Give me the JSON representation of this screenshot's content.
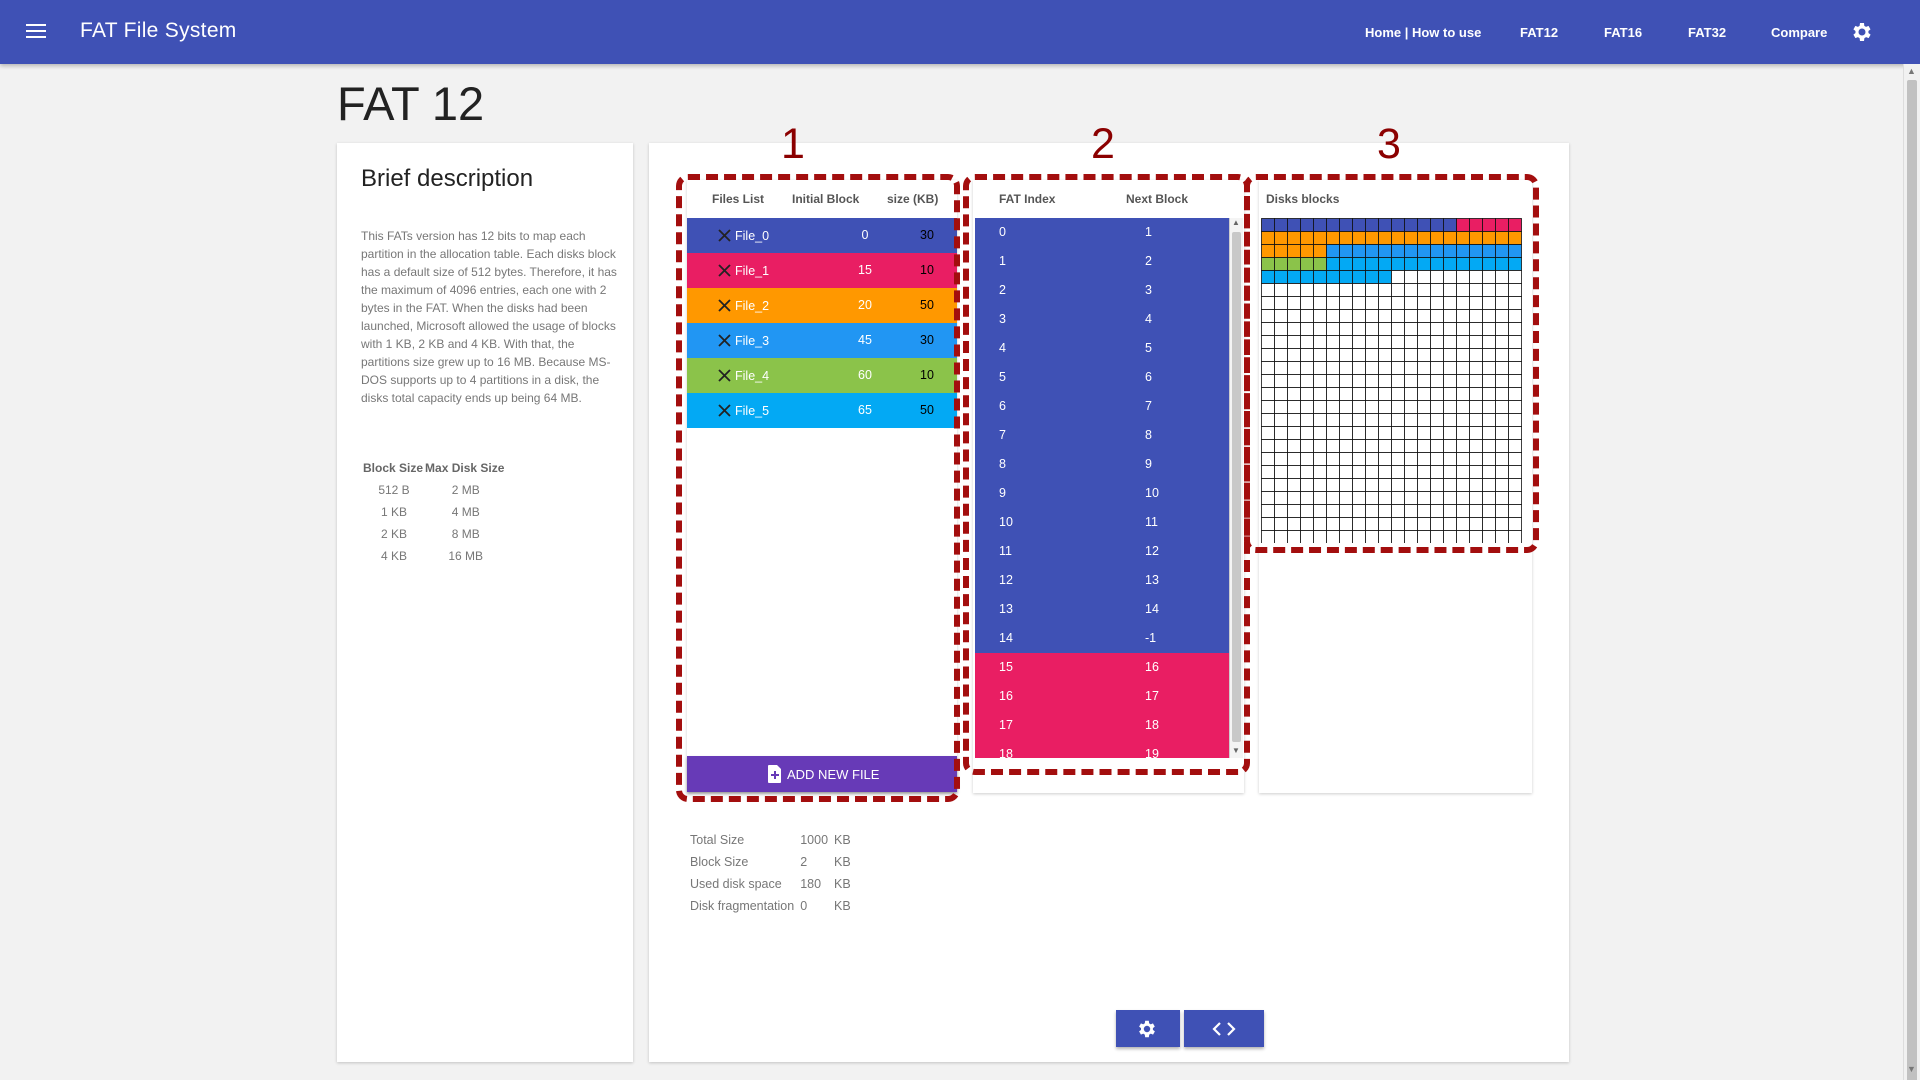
{
  "appbar": {
    "title": "FAT File System",
    "nav": [
      {
        "label": "Home | How to use"
      },
      {
        "label": "FAT12"
      },
      {
        "label": "FAT16"
      },
      {
        "label": "FAT32"
      },
      {
        "label": "Compare"
      }
    ]
  },
  "page_title": "FAT 12",
  "description": {
    "heading": "Brief description",
    "text": "This FATs version has 12 bits to map each partition in the allocation table. Each disks block has a default size of 512 bytes. Therefore, it has the maximum of 4096 entries, each one with 2 bytes in the FAT. When the disks had been launched, Microsoft allowed the usage of blocks with 1 KB, 2 KB and 4 KB. With that, the partitions size grew up to 16 MB. Because MS-DOS supports up to 4 partitions in a disk, the disks total capacity ends up being 64 MB.",
    "table_headers": [
      "Block Size",
      "Max Disk Size"
    ],
    "table_rows": [
      [
        "512 B",
        "2 MB"
      ],
      [
        "1 KB",
        "4 MB"
      ],
      [
        "2 KB",
        "8 MB"
      ],
      [
        "4 KB",
        "16 MB"
      ]
    ]
  },
  "annotations": [
    "1",
    "2",
    "3"
  ],
  "files_panel": {
    "headers": [
      "Files List",
      "Initial Block",
      "size (KB)"
    ],
    "files": [
      {
        "name": "File_0",
        "initial_block": "0",
        "size": "30",
        "color": "#3f51b5"
      },
      {
        "name": "File_1",
        "initial_block": "15",
        "size": "10",
        "color": "#e91e63"
      },
      {
        "name": "File_2",
        "initial_block": "20",
        "size": "50",
        "color": "#ff9800"
      },
      {
        "name": "File_3",
        "initial_block": "45",
        "size": "30",
        "color": "#2196f3"
      },
      {
        "name": "File_4",
        "initial_block": "60",
        "size": "10",
        "color": "#8bc34a"
      },
      {
        "name": "File_5",
        "initial_block": "65",
        "size": "50",
        "color": "#03a9f4"
      }
    ],
    "add_button": "ADD NEW FILE"
  },
  "fat_panel": {
    "headers": [
      "FAT Index",
      "Next Block"
    ],
    "rows": [
      {
        "index": "0",
        "next": "1",
        "color": "#3f51b5"
      },
      {
        "index": "1",
        "next": "2",
        "color": "#3f51b5"
      },
      {
        "index": "2",
        "next": "3",
        "color": "#3f51b5"
      },
      {
        "index": "3",
        "next": "4",
        "color": "#3f51b5"
      },
      {
        "index": "4",
        "next": "5",
        "color": "#3f51b5"
      },
      {
        "index": "5",
        "next": "6",
        "color": "#3f51b5"
      },
      {
        "index": "6",
        "next": "7",
        "color": "#3f51b5"
      },
      {
        "index": "7",
        "next": "8",
        "color": "#3f51b5"
      },
      {
        "index": "8",
        "next": "9",
        "color": "#3f51b5"
      },
      {
        "index": "9",
        "next": "10",
        "color": "#3f51b5"
      },
      {
        "index": "10",
        "next": "11",
        "color": "#3f51b5"
      },
      {
        "index": "11",
        "next": "12",
        "color": "#3f51b5"
      },
      {
        "index": "12",
        "next": "13",
        "color": "#3f51b5"
      },
      {
        "index": "13",
        "next": "14",
        "color": "#3f51b5"
      },
      {
        "index": "14",
        "next": "-1",
        "color": "#3f51b5"
      },
      {
        "index": "15",
        "next": "16",
        "color": "#e91e63"
      },
      {
        "index": "16",
        "next": "17",
        "color": "#e91e63"
      },
      {
        "index": "17",
        "next": "18",
        "color": "#e91e63"
      },
      {
        "index": "18",
        "next": "19",
        "color": "#e91e63"
      }
    ]
  },
  "disk_panel": {
    "heading": "Disks blocks",
    "columns": 20,
    "rows": 25,
    "segments": [
      {
        "start": 0,
        "count": 15,
        "color": "#3f51b5"
      },
      {
        "start": 15,
        "count": 5,
        "color": "#e91e63"
      },
      {
        "start": 20,
        "count": 25,
        "color": "#ff9800"
      },
      {
        "start": 45,
        "count": 15,
        "color": "#2196f3"
      },
      {
        "start": 60,
        "count": 5,
        "color": "#8bc34a"
      },
      {
        "start": 65,
        "count": 25,
        "color": "#03a9f4"
      }
    ]
  },
  "stats": [
    {
      "label": "Total Size",
      "value": "1000",
      "unit": "KB"
    },
    {
      "label": "Block Size",
      "value": "2",
      "unit": "KB"
    },
    {
      "label": "Used disk space",
      "value": "180",
      "unit": "KB"
    },
    {
      "label": "Disk fragmentation",
      "value": "0",
      "unit": "KB"
    }
  ],
  "icons": {
    "menu": "menu-icon",
    "settings": "gear-icon",
    "remove_file": "close-icon",
    "add_file": "file-plus-icon",
    "code": "code-icon"
  }
}
